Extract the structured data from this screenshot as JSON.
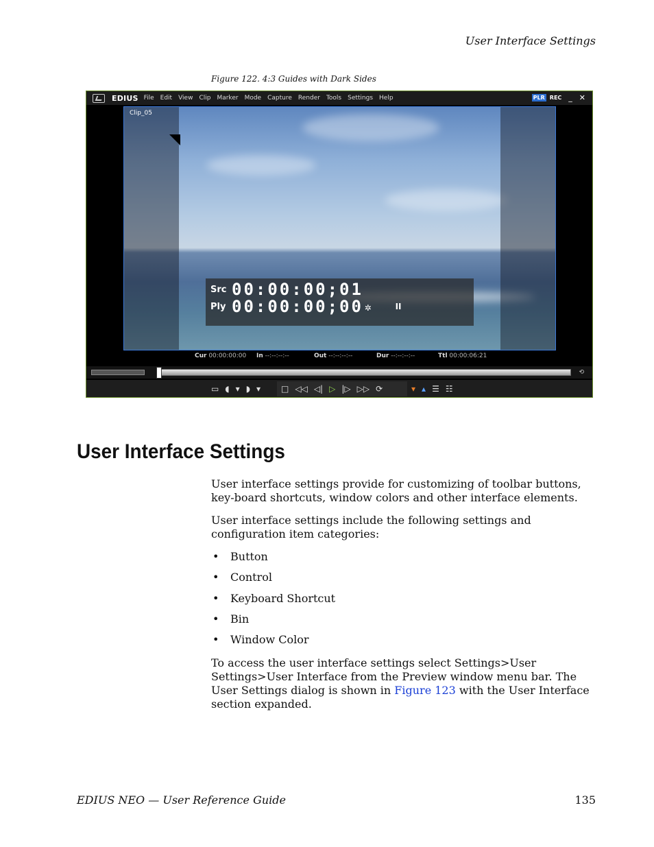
{
  "header": {
    "running_title": "User Interface Settings"
  },
  "figure": {
    "caption": "Figure 122.  4:3 Guides with Dark Sides",
    "app": {
      "brand": "EDIUS",
      "menu": [
        "File",
        "Edit",
        "View",
        "Clip",
        "Marker",
        "Mode",
        "Capture",
        "Render",
        "Tools",
        "Settings",
        "Help"
      ],
      "plr": "PLR",
      "rec": "REC",
      "minimize": "_",
      "close": "✕"
    },
    "clip_label": "Clip_05",
    "timecode": {
      "src_label": "Src",
      "src_value": "00:00:00;01",
      "ply_label": "Ply",
      "ply_value": "00:00:00;00",
      "ply_marker": "✲",
      "pause_symbol": "II"
    },
    "info": {
      "cur_label": "Cur",
      "cur_value": "00:00:00:00",
      "in_label": "In",
      "in_value": "--:--:--:--",
      "out_label": "Out",
      "out_value": "--:--:--:--",
      "dur_label": "Dur",
      "dur_value": "--:--:--:--",
      "ttl_label": "Ttl",
      "ttl_value": "00:00:06:21"
    }
  },
  "section": {
    "title": "User Interface Settings",
    "p1": "User interface settings provide for customizing of toolbar buttons, key-board shortcuts, window colors and other interface elements.",
    "p2": "User interface settings include the following settings and configuration item categories:",
    "bullets": [
      "Button",
      "Control",
      "Keyboard Shortcut",
      "Bin",
      "Window Color"
    ],
    "p3_before": "To access the user interface settings select Settings>User Settings>User Interface from the Preview window menu bar. The User Settings dialog is shown in ",
    "p3_link": "Figure 123",
    "p3_after": " with the User Interface section expanded."
  },
  "footer": {
    "left": "EDIUS NEO  —  User Reference Guide",
    "page_number": "135"
  }
}
